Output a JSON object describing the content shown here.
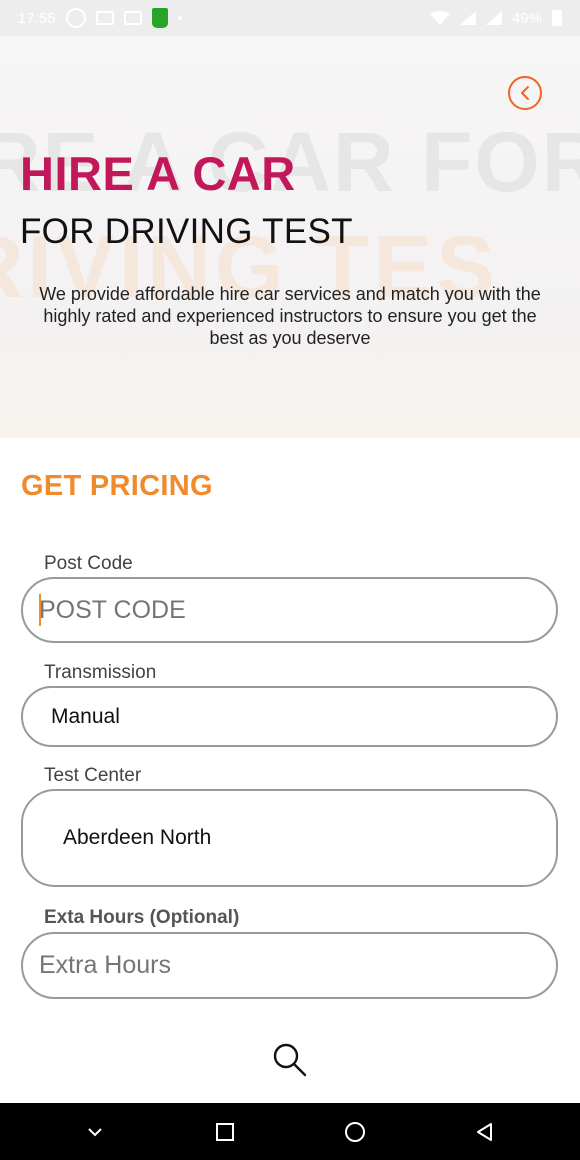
{
  "status_bar": {
    "time": "17:55",
    "battery": "49%",
    "icons": [
      "whatsapp-icon",
      "facebook-icon",
      "gmail-icon",
      "green-app-icon",
      "dot-icon",
      "wifi-icon",
      "signal-icon",
      "battery-icon"
    ]
  },
  "hero": {
    "watermark_line1": "RE A CAR FOR",
    "watermark_line2": "RIVING TES",
    "title": "HIRE A CAR",
    "subtitle": "FOR DRIVING TEST",
    "description": "We provide affordable hire car services and match you with the highly rated and experienced instructors to ensure you get the best as you deserve"
  },
  "form": {
    "section_title": "GET PRICING",
    "post_code": {
      "label": "Post Code",
      "placeholder": "POST CODE",
      "value": ""
    },
    "transmission": {
      "label": "Transmission",
      "value": "Manual"
    },
    "test_center": {
      "label": "Test Center",
      "value": "Aberdeen North"
    },
    "extra_hours": {
      "label": "Exta Hours (Optional)",
      "placeholder": "Extra Hours",
      "value": ""
    }
  },
  "actions": {
    "search_icon": "search-icon"
  },
  "nav_bar": {
    "icons": [
      "chevron-down-icon",
      "square-icon",
      "circle-icon",
      "triangle-back-icon"
    ]
  },
  "colors": {
    "accent_orange": "#f08a2a",
    "title_magenta": "#c2185b",
    "back_button": "#f26322",
    "placeholder": "#f5a623"
  }
}
